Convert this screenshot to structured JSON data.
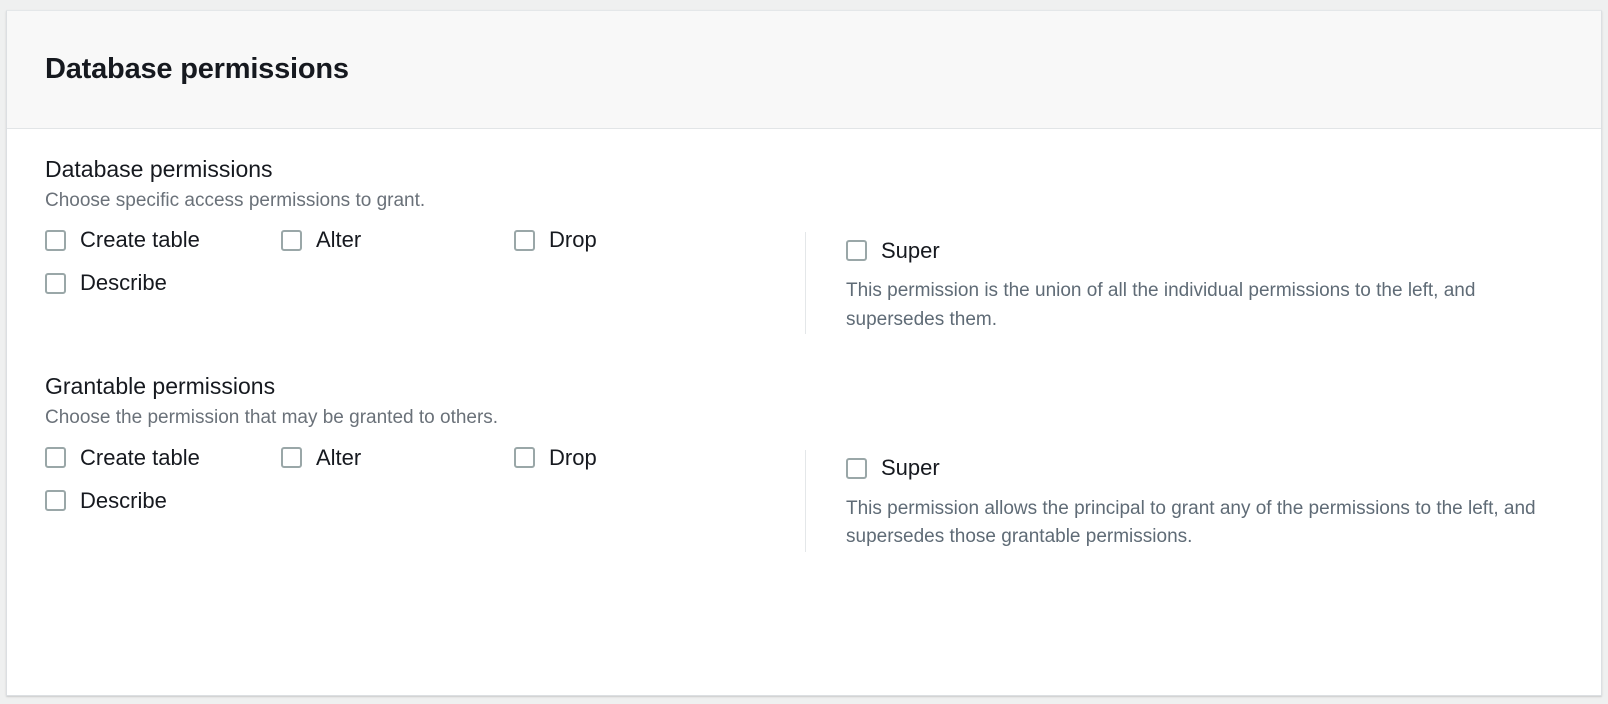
{
  "header": {
    "title": "Database permissions"
  },
  "sections": [
    {
      "heading": "Database permissions",
      "description": "Choose specific access permissions to grant.",
      "left_permissions": [
        "Create table",
        "Alter",
        "Drop",
        "Describe"
      ],
      "super_label": "Super",
      "super_description": "This permission is the union of all the individual permissions to the left, and supersedes them."
    },
    {
      "heading": "Grantable permissions",
      "description": "Choose the permission that may be granted to others.",
      "left_permissions": [
        "Create table",
        "Alter",
        "Drop",
        "Describe"
      ],
      "super_label": "Super",
      "super_description": "This permission allows the principal to grant any of the permissions to the left, and supersedes those grantable permissions."
    }
  ],
  "colors": {
    "page_background": "#eff0f0",
    "card_background": "#ffffff",
    "card_header_background": "#f8f8f8",
    "border": "#dcdfe2",
    "heading_text": "#16191f",
    "muted_text": "#6a7179",
    "checkbox_border": "#9aa7a8"
  }
}
